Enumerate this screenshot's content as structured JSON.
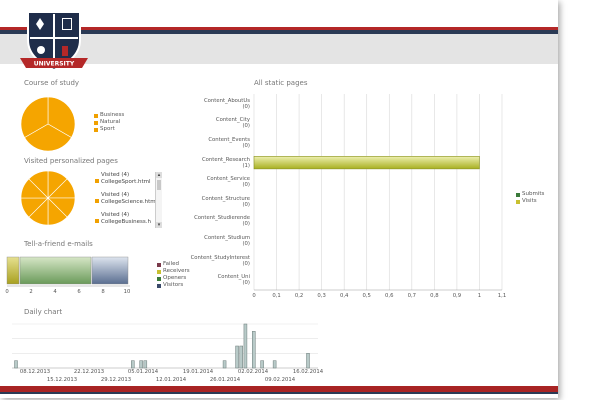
{
  "header": {
    "logo_text": "UNIVERSITY"
  },
  "course_of_study": {
    "title": "Course of study",
    "legend": [
      {
        "label": "Business",
        "color": "#f0a000"
      },
      {
        "label": "Natural",
        "color": "#f0a000"
      },
      {
        "label": "Sport",
        "color": "#f0a000"
      }
    ]
  },
  "visited_pages": {
    "title": "Visited personalized pages",
    "entries": [
      {
        "count": "Visited (4)",
        "page": "CollegeSport.html"
      },
      {
        "count": "Visited (4)",
        "page": "CollegeScience.htm"
      },
      {
        "count": "Visited (4)",
        "page": "CollegeBusiness.h"
      }
    ]
  },
  "tell_a_friend": {
    "title": "Tell-a-friend e-mails",
    "legend": [
      {
        "label": "Failed",
        "color": "#7a3a4a"
      },
      {
        "label": "Receivers",
        "color": "#c8c030"
      },
      {
        "label": "Openers",
        "color": "#3a7a3a"
      },
      {
        "label": "Visitors",
        "color": "#3a4a6a"
      }
    ],
    "x_ticks": [
      "0",
      "2",
      "4",
      "6",
      "8",
      "10"
    ]
  },
  "static_pages": {
    "title": "All static pages",
    "legend": [
      {
        "label": "Submits",
        "color": "#3a7a3a"
      },
      {
        "label": "Visits",
        "color": "#c8c030"
      }
    ]
  },
  "daily_chart": {
    "title": "Daily chart",
    "dates_top": [
      "08.12.2013",
      "22.12.2013",
      "05.01.2014",
      "19.01.2014",
      "02.02.2014",
      "16.02.2014"
    ],
    "dates_bottom": [
      "15.12.2013",
      "29.12.2013",
      "12.01.2014",
      "26.01.2014",
      "09.02.2014"
    ]
  },
  "chart_data": [
    {
      "type": "pie",
      "title": "Course of study",
      "categories": [
        "Business",
        "Natural",
        "Sport"
      ],
      "values": [
        1,
        1,
        1
      ]
    },
    {
      "type": "pie",
      "title": "Visited personalized pages",
      "categories": [
        "CollegeSport.html",
        "CollegeScience.htm",
        "CollegeBusiness.h"
      ],
      "values": [
        4,
        4,
        4
      ]
    },
    {
      "type": "bar",
      "title": "Tell-a-friend e-mails",
      "series": [
        {
          "name": "Receivers",
          "values": [
            0.6
          ]
        },
        {
          "name": "Openers",
          "values": [
            6.4
          ]
        },
        {
          "name": "Visitors",
          "values": [
            3.3
          ]
        }
      ],
      "xlim": [
        0,
        10
      ],
      "stacked": true
    },
    {
      "type": "bar",
      "title": "All static pages",
      "categories": [
        "Content_AboutUs (0)",
        "Content_City (0)",
        "Content_Events (0)",
        "Content_Research (1)",
        "Content_Service (0)",
        "Content_Structure (0)",
        "Content_Studierende (0)",
        "Content_Studium (0)",
        "Content_StudyInterest (0)",
        "Content_Uni (0)"
      ],
      "series": [
        {
          "name": "Visits",
          "values": [
            0,
            0,
            0,
            1,
            0,
            0,
            0,
            0,
            0,
            0
          ]
        },
        {
          "name": "Submits",
          "values": [
            0,
            0,
            0,
            0,
            0,
            0,
            0,
            0,
            0,
            0
          ]
        }
      ],
      "x_ticks": [
        "0",
        "0,1",
        "0,2",
        "0,3",
        "0,4",
        "0,5",
        "0,6",
        "0,7",
        "0,8",
        "0,9",
        "1",
        "1,1"
      ],
      "xlim": [
        0,
        1.1
      ],
      "legend": "right"
    },
    {
      "type": "bar",
      "title": "Daily chart",
      "x": [
        "08.12.2013",
        "05.01.2014",
        "07.01.2014",
        "08.01.2014",
        "27.01.2014",
        "30.01.2014",
        "31.01.2014",
        "01.02.2014",
        "03.02.2014",
        "05.02.2014",
        "08.02.2014",
        "16.02.2014"
      ],
      "values": [
        1,
        1,
        1,
        1,
        1,
        3,
        3,
        6,
        5,
        1,
        1,
        2
      ],
      "ylim": [
        0,
        6
      ]
    }
  ]
}
